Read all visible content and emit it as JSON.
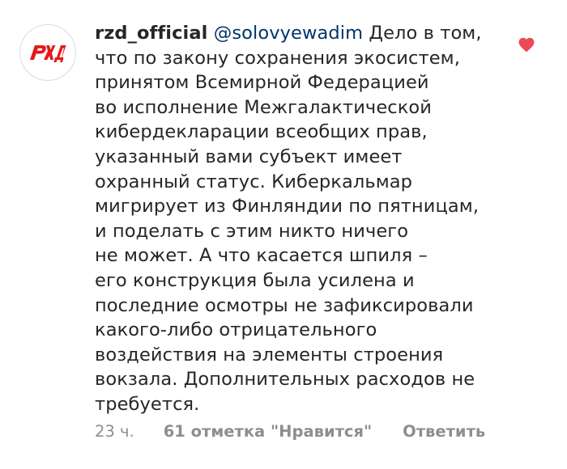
{
  "comment": {
    "username": "rzd_official",
    "mention": "@solovyewadim",
    "avatar_logo": "РЖД",
    "text_lines": [
      "Дело в том,",
      "что по закону сохранения экосистем,",
      "принятом Всемирной Федерацией",
      "во исполнение Межгалактической",
      "кибердекларации всеобщих прав,",
      "указанный вами субъект имеет",
      "охранный статус. Киберкальмар",
      "мигрирует из Финляндии по пятницам,",
      "и поделать с этим никто ничего",
      "не может. А что касается шпиля –",
      "его конструкция была усилена и",
      "последние осмотры не зафиксировали",
      "какого-либо отрицательного",
      "воздействия на элементы строения",
      "вокзала. Дополнительных расходов не",
      "требуется."
    ],
    "time": "23 ч.",
    "likes": "61 отметка \"Нравится\"",
    "reply": "Ответить",
    "like_icon": "heart-icon",
    "colors": {
      "text": "#262626",
      "mention": "#003569",
      "meta": "#8e8e8e",
      "heart": "#ed4956",
      "logo": "#e21a1a"
    }
  }
}
